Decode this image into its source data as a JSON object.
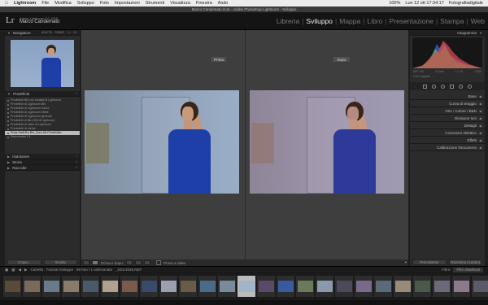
{
  "menubar": {
    "app": "Lightroom",
    "items": [
      "File",
      "Modifica",
      "Sviluppo",
      "Foto",
      "Impostazioni",
      "Strumenti",
      "Visualizza",
      "Finestra",
      "Aiuto"
    ],
    "status": "Lun 12 ott 17:34:17",
    "account": "Fotografiadigitale",
    "battery": "100%"
  },
  "window": {
    "title": "Marco Candemato.lrcat - Adobe Photoshop Lightroom - Sviluppo"
  },
  "identity": {
    "product": "Adobe Lightroom CC 2015",
    "user": "Marco Candemato",
    "logo": "Lr"
  },
  "modules": [
    "Libreria",
    "Sviluppo",
    "Mappa",
    "Libro",
    "Presentazione",
    "Stampa",
    "Web"
  ],
  "active_module": "Sviluppo",
  "left": {
    "navigator": {
      "title": "Navigatore",
      "zoom": [
        "ADATTA",
        "RIEMPI",
        "1:1",
        "3:1"
      ]
    },
    "presets": {
      "title": "Predefiniti",
      "items": [
        "Predefiniti BN con tonalità di Lightroom",
        "Predefiniti di Lightroom BN",
        "Predefiniti di Lightroom colore",
        "Predefiniti di Lightroom effetti",
        "Predefiniti di Lightroom generali",
        "Predefiniti di filtro BN di Lightroom",
        "Predefiniti di video di Lightroom",
        "Predefiniti di utente",
        "Rosa-Kadt-Bu-Blu_Dout-Ult-Predefinito",
        "Selezionato 1.1"
      ],
      "selected_index": 8
    },
    "snapshots": "Istantanee",
    "history": "Storia",
    "collections": "Raccolte",
    "copy_button": "Copia...",
    "paste_button": "Incolla"
  },
  "center": {
    "before_label": "Prima",
    "after_label": "Dopo",
    "compare_label": "Prima e dopo:",
    "soft_proof": "Prova a video"
  },
  "right": {
    "histogram": {
      "title": "Istogramma",
      "info": [
        "ISO 100",
        "24 mm",
        "f / 2,8",
        "1/250"
      ],
      "original": "Foto originale"
    },
    "sections": [
      {
        "label": "Base",
        "left": ""
      },
      {
        "label": "Curva di viraggio",
        "left": ""
      },
      {
        "label": "HSL / Colore / B&N",
        "left": ""
      },
      {
        "label": "Divisione toni",
        "left": ""
      },
      {
        "label": "Dettagli",
        "left": ""
      },
      {
        "label": "Correzioni obiettivo",
        "left": ""
      },
      {
        "label": "Effetti",
        "left": ""
      },
      {
        "label": "Calibrazione fotocamera",
        "left": ""
      }
    ],
    "prev_button": "Precedente",
    "reset_button": "Ripristina (Adobe)"
  },
  "filmbar": {
    "source": "Cartella : Tutorial Sviluppo",
    "count": "89 foto / 1 selezionata",
    "filename": "_DSC4025.NEF",
    "filter_label": "Filtro:",
    "filter_value": "Filtri disattivati"
  },
  "filmstrip": {
    "count": 25,
    "selected_index": 12,
    "colors": [
      "#5a4a3a",
      "#7a6a5a",
      "#6a7a8a",
      "#8a7a6a",
      "#4a5a6a",
      "#b0a090",
      "#7a5a4a",
      "#3a4a6a",
      "#9aa0b0",
      "#6a5a4a",
      "#4a6a8a",
      "#7a8a9a",
      "#a0b4cc",
      "#5a4a6a",
      "#3a5aa0",
      "#6a7a5a",
      "#8a9aaa",
      "#4a4a5a",
      "#7a6a8a",
      "#5a6a7a",
      "#9a8a7a",
      "#4a5a4a",
      "#6a6a7a",
      "#8a7a8a",
      "#5a5a6a"
    ]
  }
}
